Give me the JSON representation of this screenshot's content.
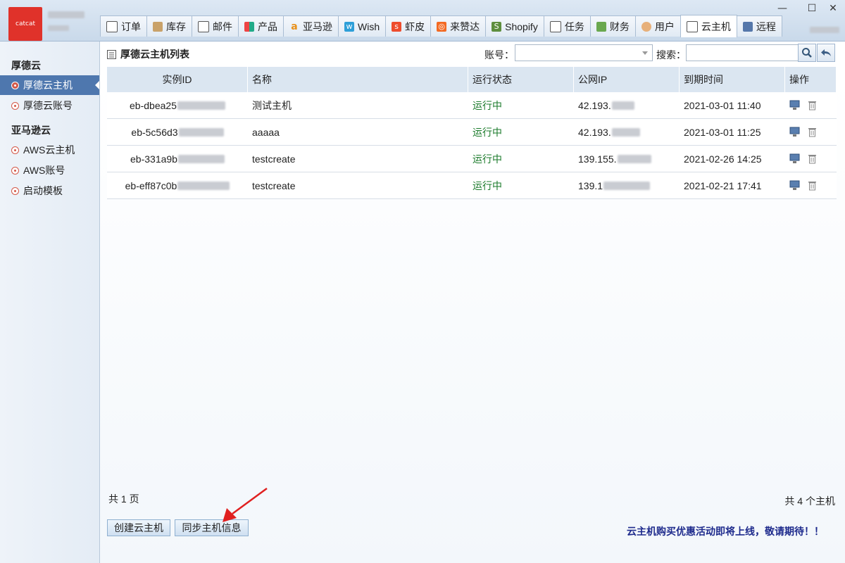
{
  "app": {
    "logo_text": "catcat",
    "window_controls": {
      "minimize": "—",
      "maximize": "☐",
      "close": "✕"
    }
  },
  "tabs": [
    {
      "label": "订单",
      "icon": "clipboard-icon"
    },
    {
      "label": "库存",
      "icon": "box-icon"
    },
    {
      "label": "邮件",
      "icon": "mail-icon"
    },
    {
      "label": "产品",
      "icon": "grid-icon"
    },
    {
      "label": "亚马逊",
      "icon": "amazon-icon"
    },
    {
      "label": "Wish",
      "icon": "wish-icon"
    },
    {
      "label": "虾皮",
      "icon": "shopee-icon"
    },
    {
      "label": "来赞达",
      "icon": "lazada-icon"
    },
    {
      "label": "Shopify",
      "icon": "shopify-icon"
    },
    {
      "label": "任务",
      "icon": "task-icon"
    },
    {
      "label": "财务",
      "icon": "money-icon"
    },
    {
      "label": "用户",
      "icon": "user-icon"
    },
    {
      "label": "云主机",
      "icon": "server-list-icon",
      "active": true
    },
    {
      "label": "远程",
      "icon": "monitor-icon"
    }
  ],
  "sidebar": {
    "groups": [
      {
        "title": "厚德云",
        "items": [
          {
            "label": "厚德云主机",
            "active": true
          },
          {
            "label": "厚德云账号"
          }
        ]
      },
      {
        "title": "亚马逊云",
        "items": [
          {
            "label": "AWS云主机"
          },
          {
            "label": "AWS账号"
          },
          {
            "label": "启动模板"
          }
        ]
      }
    ]
  },
  "main": {
    "title": "厚德云主机列表",
    "account_label": "账号：",
    "account_value": "",
    "search_label": "搜索：",
    "search_value": "",
    "columns": [
      "实例ID",
      "名称",
      "运行状态",
      "公网IP",
      "到期时间",
      "操作"
    ],
    "rows": [
      {
        "id": "eb-dbea25",
        "name": "测试主机",
        "status": "运行中",
        "ip": "42.193.",
        "expire": "2021-03-01 11:40"
      },
      {
        "id": "eb-5c56d3",
        "name": "aaaaa",
        "status": "运行中",
        "ip": "42.193.",
        "expire": "2021-03-01 11:25"
      },
      {
        "id": "eb-331a9b",
        "name": "testcreate",
        "status": "运行中",
        "ip": "139.155.",
        "expire": "2021-02-26 14:25"
      },
      {
        "id": "eb-eff87c0b",
        "name": "testcreate",
        "status": "运行中",
        "ip": "139.1",
        "expire": "2021-02-21 17:41"
      }
    ],
    "pages_text": "共 1 页",
    "count_text": "共 4 个主机",
    "create_button": "创建云主机",
    "sync_button": "同步主机信息",
    "promo_text": "云主机购买优惠活动即将上线，敬请期待！！"
  },
  "colors": {
    "accent": "#4e77ae",
    "running": "#1a7a2a",
    "promo": "#1d2a8c",
    "logo_bg": "#e0322a",
    "annotation_arrow": "#e02020"
  }
}
